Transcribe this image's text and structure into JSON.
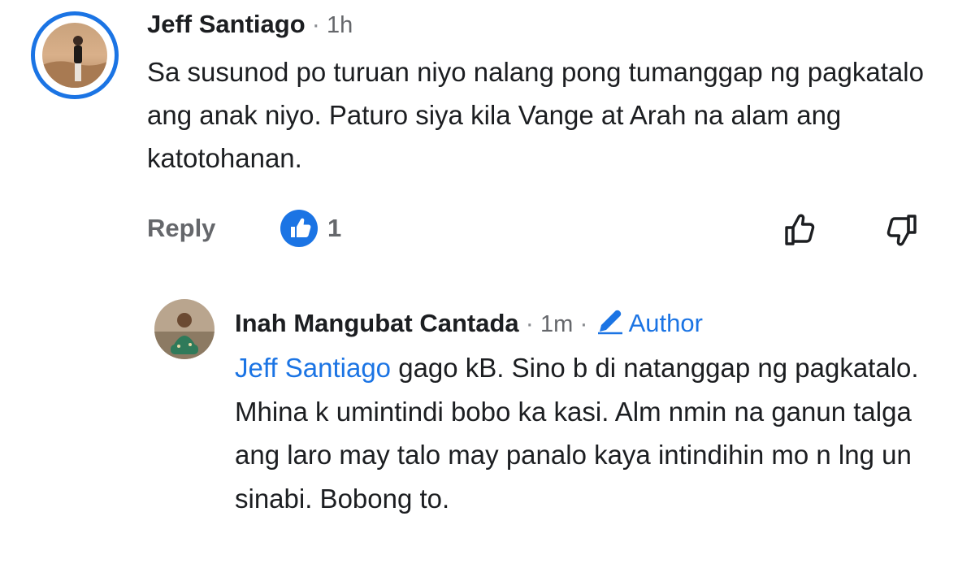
{
  "comments": [
    {
      "author": "Jeff Santiago",
      "separator": "·",
      "time": "1h",
      "text": "Sa susunod po turuan niyo nalang pong tumanggap ng pagkatalo ang anak niyo. Paturo siya kila Vange at Arah na alam ang katotohanan.",
      "reply_label": "Reply",
      "like_count": "1",
      "avatar_ring_color": "#1b74e4"
    }
  ],
  "reply": {
    "author": "Inah Mangubat Cantada",
    "separator": "·",
    "time": "1m",
    "badge": "Author",
    "mention": "Jeff Santiago",
    "text": " gago kB. Sino b di natanggap ng pagkatalo. Mhina k umintindi bobo ka kasi. Alm nmin na ganun talga ang laro may talo may panalo kaya intindihin mo n lng un sinabi. Bobong to."
  },
  "colors": {
    "accent": "#1b74e4",
    "secondary_text": "#65676b",
    "primary_text": "#1c1e21"
  },
  "icons": {
    "like_badge": "thumbs-up-icon",
    "upvote": "thumbs-up-outline-icon",
    "downvote": "thumbs-down-outline-icon",
    "author_badge": "pencil-icon"
  }
}
